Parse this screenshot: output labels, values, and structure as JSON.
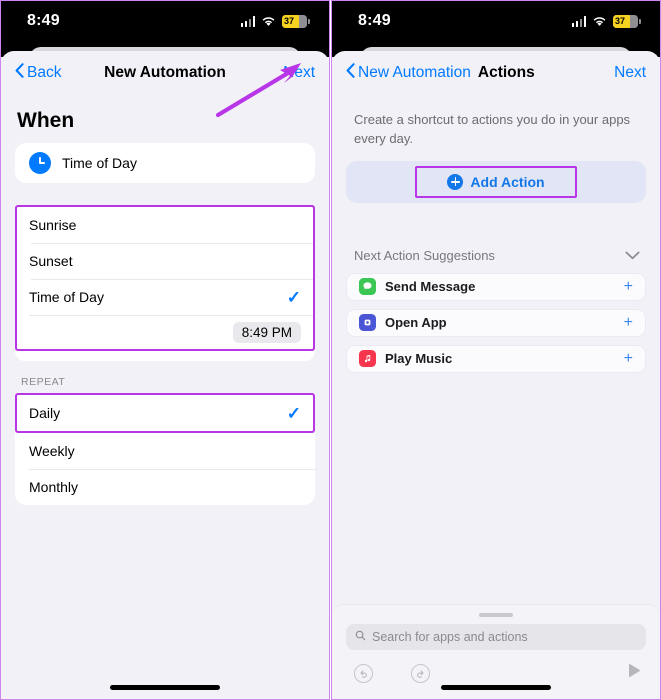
{
  "status_bar": {
    "time": "8:49",
    "battery_percent": "37",
    "battery_color": "#f5d120",
    "cellular_icon": "cellular-bars-icon",
    "wifi_icon": "wifi-icon"
  },
  "theme": {
    "accent_blue": "#007aff",
    "highlight_purple": "#b835e8",
    "page_background": "#f2f1f7",
    "card_background": "#ffffff"
  },
  "left_panel": {
    "nav": {
      "back_label": "Back",
      "title": "New Automation",
      "next_label": "Next"
    },
    "heading": "When",
    "trigger": {
      "label": "Time of Day",
      "icon": "clock-icon"
    },
    "options": [
      {
        "label": "Sunrise",
        "selected": false
      },
      {
        "label": "Sunset",
        "selected": false
      },
      {
        "label": "Time of Day",
        "selected": true
      }
    ],
    "selected_time": "8:49 PM",
    "repeat_section_label": "REPEAT",
    "repeat_options": [
      {
        "label": "Daily",
        "selected": true
      },
      {
        "label": "Weekly",
        "selected": false
      },
      {
        "label": "Monthly",
        "selected": false
      }
    ],
    "checkmark_glyph": "✓",
    "annotation": "arrow-pointing-to-next-button"
  },
  "right_panel": {
    "nav": {
      "back_label": "New Automation",
      "title": "Actions",
      "next_label": "Next"
    },
    "subtitle": "Create a shortcut to actions you do in your apps every day.",
    "add_action_label": "Add Action",
    "suggestions_header": "Next Action Suggestions",
    "suggestions": [
      {
        "label": "Send Message",
        "icon": "messages-app-icon",
        "color": "#3cc755",
        "add_glyph": "+"
      },
      {
        "label": "Open App",
        "icon": "shortcuts-open-app-icon",
        "color": "#4a56d6",
        "add_glyph": "+"
      },
      {
        "label": "Play Music",
        "icon": "music-app-icon",
        "color": "#f8354f",
        "add_glyph": "+"
      }
    ],
    "search_placeholder": "Search for apps and actions",
    "toolbar": {
      "undo_icon": "undo-icon",
      "redo_icon": "redo-icon",
      "play_icon": "play-icon"
    }
  }
}
